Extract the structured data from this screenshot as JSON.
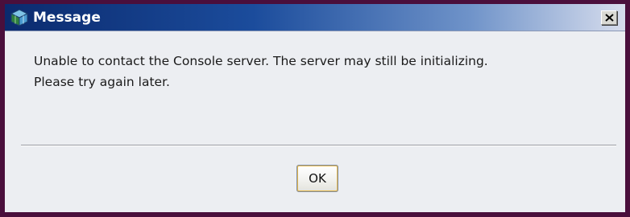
{
  "window": {
    "title": "Message",
    "icon": "application-cube-icon",
    "close_label": "X"
  },
  "message": {
    "line1": "Unable to contact the Console server. The server may still be initializing.",
    "line2": "Please try again later."
  },
  "buttons": {
    "ok_label": "OK"
  },
  "colors": {
    "window_frame": "#4a0f3c",
    "title_gradient_start": "#0b2a6e",
    "title_gradient_end": "#d7dded",
    "dialog_background": "#eceef2",
    "ok_focus_border": "#e6b84a"
  }
}
